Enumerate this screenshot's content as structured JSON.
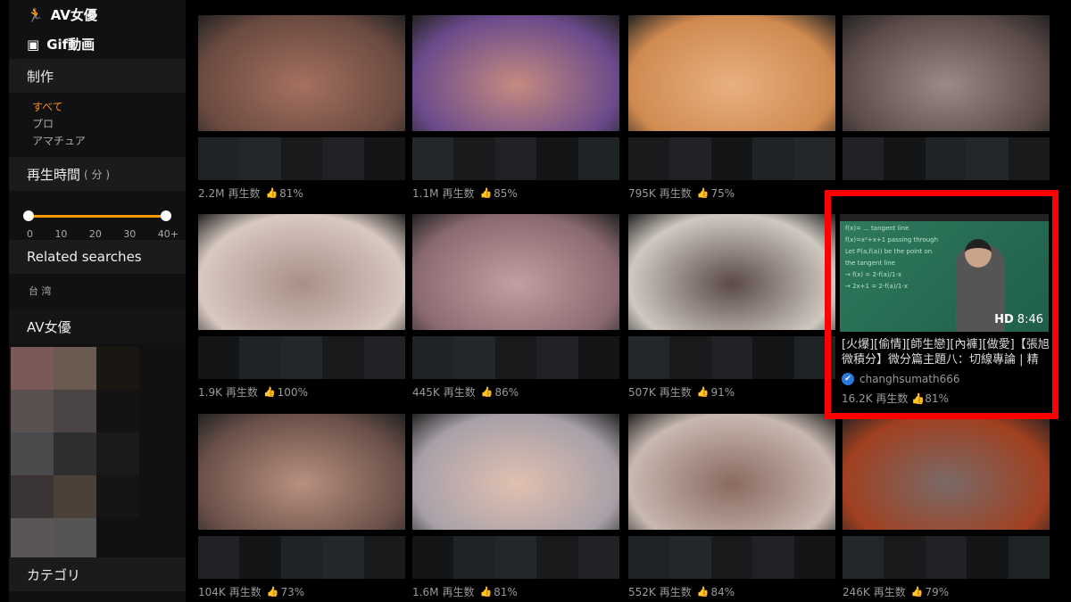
{
  "sidebar": {
    "links": [
      {
        "label": "AV女優",
        "icon": "pornstar-icon"
      },
      {
        "label": "Gif動画",
        "icon": "gif-icon"
      }
    ],
    "production": {
      "title": "制作",
      "options": [
        {
          "label": "すべて",
          "active": true
        },
        {
          "label": "プロ",
          "active": false
        },
        {
          "label": "アマチュア",
          "active": false
        }
      ]
    },
    "duration": {
      "title": "再生時間",
      "unit": "( 分 )",
      "ticks": [
        "0",
        "10",
        "20",
        "30",
        "40+"
      ],
      "range": [
        0,
        40
      ]
    },
    "related": {
      "title": "Related searches",
      "items": [
        "台 湾"
      ]
    },
    "pornstars": {
      "title": "AV女優"
    },
    "categories": {
      "title": "カテゴリ"
    }
  },
  "views_label": "再生数",
  "accent": "#f90",
  "cards": [
    {
      "views": "2.2M",
      "rating": "81%",
      "c": [
        "#6a4a40",
        "#a57060"
      ]
    },
    {
      "views": "1.1M",
      "rating": "85%",
      "c": [
        "#6a4a8a",
        "#c58a80"
      ]
    },
    {
      "views": "795K",
      "rating": "75%",
      "c": [
        "#d08a50",
        "#e8b080"
      ]
    },
    {
      "views": "",
      "rating": "",
      "c": [
        "#5a4a48",
        "#9a8a88"
      ]
    },
    {
      "views": "1.9K",
      "rating": "100%",
      "c": [
        "#d8c8c0",
        "#a89088"
      ]
    },
    {
      "views": "445K",
      "rating": "86%",
      "c": [
        "#8a6a70",
        "#c0a0a0"
      ]
    },
    {
      "views": "507K",
      "rating": "91%",
      "c": [
        "#cfc8c0",
        "#5a4a48"
      ]
    },
    null,
    {
      "views": "104K",
      "rating": "73%",
      "c": [
        "#6a5048",
        "#b89080"
      ]
    },
    {
      "views": "1.6M",
      "rating": "81%",
      "c": [
        "#a8a0a8",
        "#e0c0b0"
      ]
    },
    {
      "views": "552K",
      "rating": "84%",
      "c": [
        "#c8b8b0",
        "#8a6a60"
      ]
    },
    {
      "views": "246K",
      "rating": "79%",
      "c": [
        "#a04020",
        "#7a6a68"
      ]
    }
  ],
  "highlight": {
    "duration": "8:46",
    "hd": "HD",
    "title": "[火爆][偷情][師生戀][內褲][做愛]【張旭微積分】微分篇主題八：切線專論 | 精",
    "channel": "changhsumath666",
    "views": "16.2K",
    "rating": "81%",
    "highlight_color": "#ff0000"
  }
}
